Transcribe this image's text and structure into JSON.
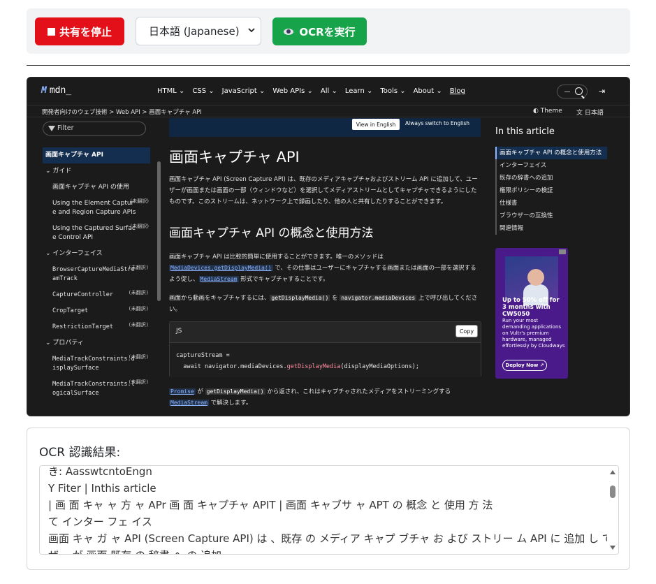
{
  "toolbar": {
    "stop_label": "共有を停止",
    "language_selected": "日本語 (Japanese)",
    "ocr_label": "OCRを実行"
  },
  "capture": {
    "logo": "mdn_",
    "nav": [
      "HTML ⌄",
      "CSS ⌄",
      "JavaScript ⌄",
      "Web APIs ⌄",
      "All ⌄",
      "Learn ⌄",
      "Tools ⌄",
      "About ⌄",
      "Blog"
    ],
    "breadcrumb": "開発者向けのウェブ技術  >  Web API  >  画面キャプチャ API",
    "theme": "Theme",
    "lang": "日本語",
    "filter_placeholder": "Filter",
    "sidebar": [
      {
        "label": "画面キャプチャ API",
        "type": "active"
      },
      {
        "label": "⌄ ガイド",
        "type": "section"
      },
      {
        "label": "画面キャプチャ API の使用",
        "type": "indent"
      },
      {
        "label": "Using the Element Capture and Region Capture APIs",
        "type": "indent",
        "tag": "(未翻訳)"
      },
      {
        "label": "Using the Captured Surface Control API",
        "type": "indent",
        "tag": "(未翻訳)"
      },
      {
        "label": "⌄ インターフェイス",
        "type": "section"
      },
      {
        "label": "BrowserCaptureMediaStreamTrack",
        "type": "mono",
        "tag": "(未翻訳)"
      },
      {
        "label": "CaptureController",
        "type": "mono",
        "tag": "(未翻訳)"
      },
      {
        "label": "CropTarget",
        "type": "mono",
        "tag": "(未翻訳)"
      },
      {
        "label": "RestrictionTarget",
        "type": "mono",
        "tag": "(未翻訳)"
      },
      {
        "label": "⌄ プロパティ",
        "type": "section"
      },
      {
        "label": "MediaTrackConstraints.displaySurface",
        "type": "mono",
        "tag": "(未翻訳)"
      },
      {
        "label": "MediaTrackConstraints.logicalSurface",
        "type": "mono",
        "tag": "(未翻訳)"
      }
    ],
    "banner_view": "View in English",
    "banner_always": "Always switch to English",
    "h1": "画面キャプチャ API",
    "intro": "画面キャプチャ API (Screen Capture API) は、既存のメディアキャプチャおよびストリーム API に追加して、ユーザーが画面または画面の一部（ウィンドウなど）を選択してメディアストリームとしてキャプチャできるようにしたものです。このストリームは、ネットワーク上で録画したり、他の人と共有したりすることができます。",
    "h2": "画面キャプチャ API の概念と使用方法",
    "p1_a": "画面キャプチャ API は比較的簡単に使用することができます。唯一のメソッドは ",
    "p1_code": "MediaDevices.getDisplayMedia()",
    "p1_b": " で、その仕事はユーザーにキャプチャする画面または画面の一部を選択するよう促し、",
    "p1_code2": "MediaStream",
    "p1_c": " 形式でキャプチャすることです。",
    "p2_a": "画面から動画をキャプチャするには、",
    "p2_code": "getDisplayMedia()",
    "p2_b": " を ",
    "p2_code2": "navigator.mediaDevices",
    "p2_c": " 上で呼び出してください。",
    "code_lang": "JS",
    "code_copy": "Copy",
    "code_line1": "captureStream =",
    "code_line2_a": "  await navigator.mediaDevices.",
    "code_line2_fn": "getDisplayMedia",
    "code_line2_b": "(displayMediaOptions);",
    "p3_code": "Promise",
    "p3_a": " が ",
    "p3_code2": "getDisplayMedia()",
    "p3_b": " から返され、これはキャプチャされたメディアをストリーミングする ",
    "p3_code3": "MediaStream",
    "p3_c": " で解決します。",
    "toc_title": "In this article",
    "toc": [
      "画面キャプチャ API の概念と使用方法",
      "インターフェイス",
      "既存の辞書への追加",
      "権限ポリシーの検証",
      "仕様書",
      "ブラウザーの互換性",
      "関連情報"
    ],
    "ad_big": "Up to 50% off for 3 months with CW5050",
    "ad_small": "Run your most demanding applications on Vultr's premium hardware, managed effortlessly by Cloudways",
    "ad_button": "Deploy Now ↗"
  },
  "ocr": {
    "title": "OCR 認識結果:",
    "lines": [
      "き: AasswtcntoEngn",
      "Y Fiter | Inthis article",
      "| 画 面 キャ ャ 方 ャ APr 画 面 キャプチャ APIT | 画面 キャブサ ャ APT の 概念 と 使用 方 法",
      "て インター フェ イス",
      "画面 キャ ガ ャ API (Screen Capture API) は 、既存 の メディア キャプ ブチャ お よび ストリー ム API に 追加 し て 、 ユー",
      "ザー が 画面 既存 の 辞書 へ の 追加"
    ]
  },
  "colors": {
    "stop": "#e3101a",
    "ocr_button": "#16a34a",
    "mdn_bg": "#1b1b1b",
    "accent": "#8cb4ff"
  }
}
